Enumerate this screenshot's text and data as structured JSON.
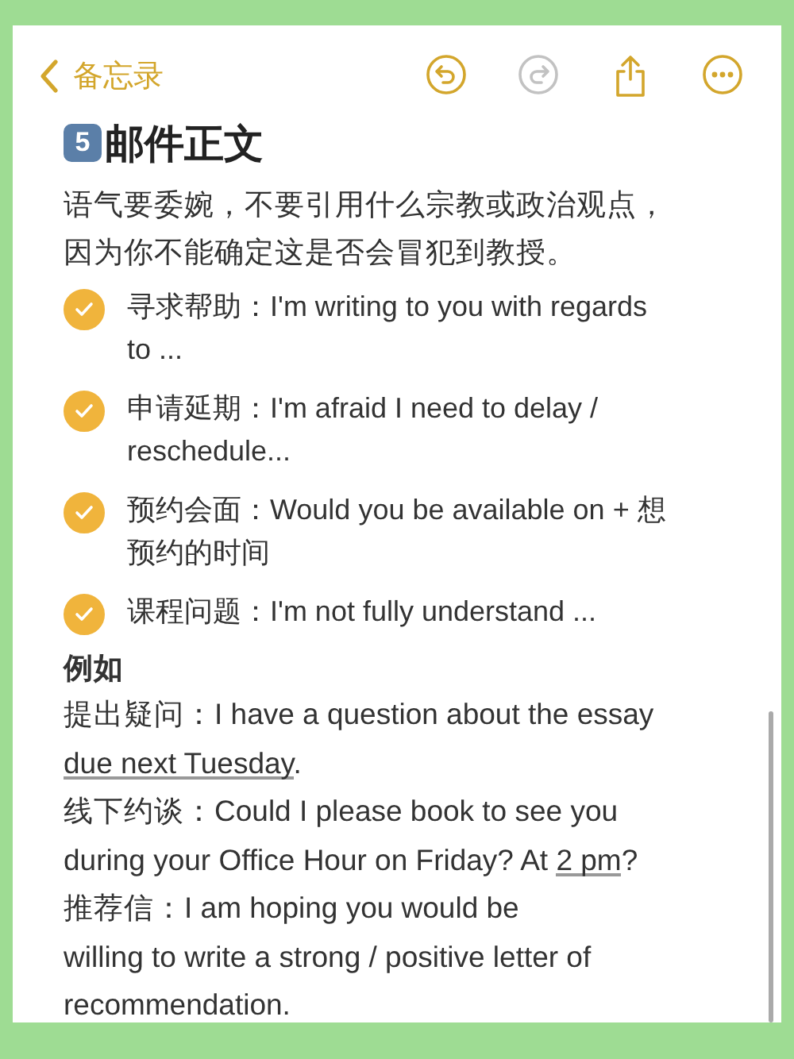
{
  "nav": {
    "back_label": "备忘录",
    "toolbar": [
      {
        "kind": "undo",
        "disabled": false
      },
      {
        "kind": "redo",
        "disabled": true
      },
      {
        "kind": "share",
        "disabled": false
      },
      {
        "kind": "more",
        "disabled": false
      }
    ]
  },
  "note": {
    "badge": "5",
    "title": "邮件正文",
    "intro": "语气要委婉，不要引用什么宗教或政治观点，因为你不能确定这是否会冒犯到教授。",
    "checklist": [
      {
        "text": "寻求帮助：I'm writing to you with regards to ...",
        "checked": true
      },
      {
        "text": "申请延期：I'm afraid I need to delay / reschedule...",
        "checked": true
      },
      {
        "text": "预约会面：Would you be available on + 想预约的时间",
        "checked": true
      },
      {
        "text": "课程问题：I'm not fully understand ...",
        "checked": true
      }
    ],
    "examples_heading": "例如",
    "examples": [
      {
        "parts": [
          {
            "text": "提出疑问：I have a question about the essay\n",
            "underlined": false
          },
          {
            "text": "due next Tuesday",
            "underlined": true
          },
          {
            "text": ".",
            "underlined": false
          }
        ]
      },
      {
        "parts": [
          {
            "text": "线下约谈：Could I please book to see you\nduring your Office Hour on Friday? At ",
            "underlined": false
          },
          {
            "text": "2 pm",
            "underlined": true
          },
          {
            "text": "?",
            "underlined": false
          }
        ]
      },
      {
        "parts": [
          {
            "text": "推荐信：I am hoping you would be\nwilling to write a strong / positive letter of\nrecommendation.",
            "underlined": false
          }
        ]
      }
    ]
  }
}
